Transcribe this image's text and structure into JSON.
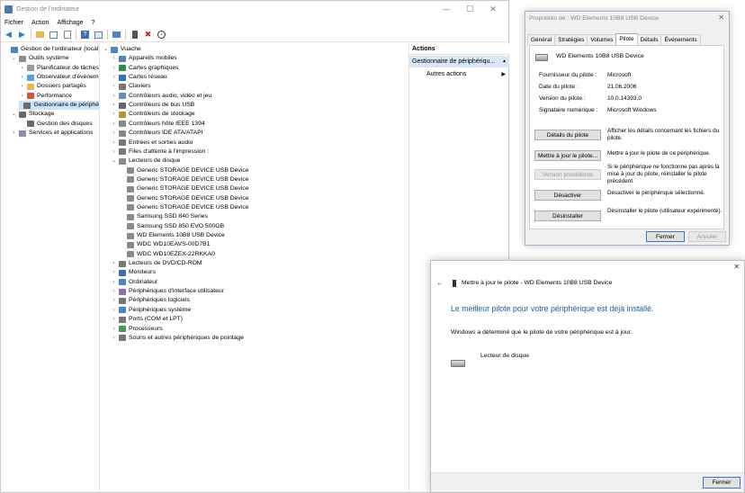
{
  "main_window": {
    "title": "Gestion de l'ordinateur",
    "controls": {
      "minimize": "—",
      "maximize": "☐",
      "close": "✕"
    },
    "menu": [
      "Fichier",
      "Action",
      "Affichage",
      "?"
    ],
    "left_tree": [
      {
        "label": "Gestion de l'ordinateur (local)",
        "level": 0,
        "expander": "",
        "icon": "computer-icon"
      },
      {
        "label": "Outils système",
        "level": 1,
        "expander": "⌄",
        "icon": "tools-icon"
      },
      {
        "label": "Planificateur de tâches",
        "level": 2,
        "expander": "›",
        "icon": "clock-icon"
      },
      {
        "label": "Observateur d'événeme",
        "level": 2,
        "expander": "›",
        "icon": "event-viewer-icon"
      },
      {
        "label": "Dossiers partagés",
        "level": 2,
        "expander": "›",
        "icon": "folder-icon"
      },
      {
        "label": "Performance",
        "level": 2,
        "expander": "›",
        "icon": "performance-icon"
      },
      {
        "label": "Gestionnaire de périphé",
        "level": 2,
        "expander": "",
        "icon": "device-manager-icon",
        "selected": true
      },
      {
        "label": "Stockage",
        "level": 1,
        "expander": "⌄",
        "icon": "storage-icon"
      },
      {
        "label": "Gestion des disques",
        "level": 2,
        "expander": "",
        "icon": "disk-icon"
      },
      {
        "label": "Services et applications",
        "level": 1,
        "expander": "›",
        "icon": "services-icon"
      }
    ],
    "device_tree": [
      {
        "label": "Vuache",
        "level": 0,
        "expander": "⌄",
        "icon": "computer-icon"
      },
      {
        "label": "Appareils mobiles",
        "level": 1,
        "expander": "›",
        "icon": "mobile-icon"
      },
      {
        "label": "Cartes graphiques",
        "level": 1,
        "expander": "›",
        "icon": "display-adapter-icon"
      },
      {
        "label": "Cartes réseau",
        "level": 1,
        "expander": "›",
        "icon": "network-icon"
      },
      {
        "label": "Claviers",
        "level": 1,
        "expander": "›",
        "icon": "keyboard-icon"
      },
      {
        "label": "Contrôleurs audio, vidéo et jeu",
        "level": 1,
        "expander": "›",
        "icon": "audio-icon"
      },
      {
        "label": "Contrôleurs de bus USB",
        "level": 1,
        "expander": "›",
        "icon": "usb-icon"
      },
      {
        "label": "Contrôleurs de stockage",
        "level": 1,
        "expander": "›",
        "icon": "storage-controller-icon"
      },
      {
        "label": "Contrôleurs hôte IEEE 1394",
        "level": 1,
        "expander": "›",
        "icon": "ieee1394-icon"
      },
      {
        "label": "Contrôleurs IDE ATA/ATAPI",
        "level": 1,
        "expander": "›",
        "icon": "ide-icon"
      },
      {
        "label": "Entrées et sorties audio",
        "level": 1,
        "expander": "›",
        "icon": "speaker-icon"
      },
      {
        "label": "Files d'attente à l'impression :",
        "level": 1,
        "expander": "›",
        "icon": "printer-icon"
      },
      {
        "label": "Lecteurs de disque",
        "level": 1,
        "expander": "⌄",
        "icon": "disk-drive-icon"
      },
      {
        "label": "Generic STORAGE DEVICE USB Device",
        "level": 2,
        "expander": "",
        "icon": "disk-drive-icon"
      },
      {
        "label": "Generic STORAGE DEVICE USB Device",
        "level": 2,
        "expander": "",
        "icon": "disk-drive-icon"
      },
      {
        "label": "Generic STORAGE DEVICE USB Device",
        "level": 2,
        "expander": "",
        "icon": "disk-drive-icon"
      },
      {
        "label": "Generic STORAGE DEVICE USB Device",
        "level": 2,
        "expander": "",
        "icon": "disk-drive-icon"
      },
      {
        "label": "Generic STORAGE DEVICE USB Device",
        "level": 2,
        "expander": "",
        "icon": "disk-drive-icon"
      },
      {
        "label": "Samsung SSD 840 Series",
        "level": 2,
        "expander": "",
        "icon": "disk-drive-icon"
      },
      {
        "label": "Samsung SSD 850 EVO 500GB",
        "level": 2,
        "expander": "",
        "icon": "disk-drive-icon"
      },
      {
        "label": "WD Elements 10B8 USB Device",
        "level": 2,
        "expander": "",
        "icon": "disk-drive-icon"
      },
      {
        "label": "WDC WD10EAVS-00D7B1",
        "level": 2,
        "expander": "",
        "icon": "disk-drive-icon"
      },
      {
        "label": "WDC WD10EZEX-22RKKA0",
        "level": 2,
        "expander": "",
        "icon": "disk-drive-icon"
      },
      {
        "label": "Lecteurs de DVD/CD-ROM",
        "level": 1,
        "expander": "›",
        "icon": "dvd-icon"
      },
      {
        "label": "Moniteurs",
        "level": 1,
        "expander": "›",
        "icon": "monitor-icon"
      },
      {
        "label": "Ordinateur",
        "level": 1,
        "expander": "›",
        "icon": "computer-icon"
      },
      {
        "label": "Périphériques d'interface utilisateur",
        "level": 1,
        "expander": "›",
        "icon": "hid-icon"
      },
      {
        "label": "Périphériques logiciels",
        "level": 1,
        "expander": "›",
        "icon": "software-device-icon"
      },
      {
        "label": "Périphériques système",
        "level": 1,
        "expander": "›",
        "icon": "system-device-icon"
      },
      {
        "label": "Ports (COM et LPT)",
        "level": 1,
        "expander": "›",
        "icon": "port-icon"
      },
      {
        "label": "Processeurs",
        "level": 1,
        "expander": "›",
        "icon": "processor-icon"
      },
      {
        "label": "Souris et autres périphériques de pointage",
        "level": 1,
        "expander": "›",
        "icon": "mouse-icon"
      }
    ],
    "actions": {
      "header": "Actions",
      "section": "Gestionnaire de périphériqu...",
      "section_arrow": "▲",
      "other": "Autres actions",
      "other_arrow": "▶"
    }
  },
  "properties_dialog": {
    "title": "Propriétés de : WD Elements 10B8 USB Device",
    "close": "✕",
    "tabs": [
      "Général",
      "Stratégies",
      "Volumes",
      "Pilote",
      "Détails",
      "Événements"
    ],
    "active_tab": "Pilote",
    "device_name": "WD Elements 10B8 USB Device",
    "info": [
      {
        "label": "Fournisseur du pilote :",
        "value": "Microsoft"
      },
      {
        "label": "Date du pilote :",
        "value": "21.06.2006"
      },
      {
        "label": "Version du pilote :",
        "value": "10.0.14393.0"
      },
      {
        "label": "Signataire numérique :",
        "value": "Microsoft Windows"
      }
    ],
    "buttons": [
      {
        "label": "Détails du pilote",
        "desc": "Afficher les détails concernant les fichiers du pilote.",
        "disabled": false
      },
      {
        "label": "Mettre à jour le pilote...",
        "desc": "Mettre à jour le pilote de ce périphérique.",
        "disabled": false
      },
      {
        "label": "Version précédente",
        "desc": "Si le périphérique ne fonctionne pas après la mise à jour du pilote, réinstaller le pilote précédent.",
        "disabled": true
      },
      {
        "label": "Désactiver",
        "desc": "Désactiver le périphérique sélectionné.",
        "disabled": false
      },
      {
        "label": "Désinstaller",
        "desc": "Désinstaller le pilote (utilisateur expérimenté).",
        "disabled": false
      }
    ],
    "ok_label": "Fermer",
    "cancel_label": "Annuler"
  },
  "update_dialog": {
    "close": "✕",
    "back": "←",
    "title": "Mettre à jour le pilote - WD Elements 10B8 USB Device",
    "heading": "Le meilleur pilote pour votre périphérique est déjà installé.",
    "message": "Windows a déterminé que le pilote de votre périphérique est à jour.",
    "device_label": "Lecteur de disque",
    "close_button": "Fermer"
  },
  "colors": {
    "accent": "#1c5fa8",
    "selection": "#cce4f7",
    "heading_blue": "#1a5ea8"
  }
}
